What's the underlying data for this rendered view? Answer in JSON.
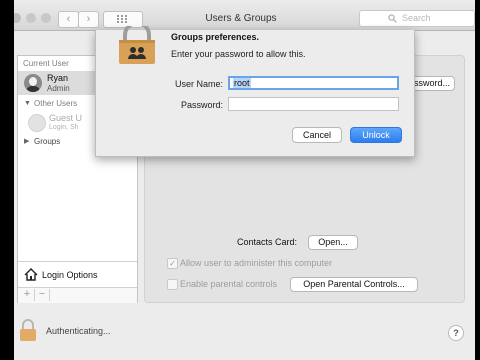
{
  "window": {
    "title": "Users & Groups",
    "search_placeholder": "Search"
  },
  "nav": {
    "back": "‹",
    "forward": "›"
  },
  "sidebar": {
    "current_user_heading": "Current User",
    "current_user": {
      "name": "Ryan",
      "role": "Admin"
    },
    "other_users_heading": "Other Users",
    "guest": {
      "name": "Guest U",
      "subtitle": "Login, Sh"
    },
    "groups_label": "Groups",
    "login_options": "Login Options",
    "add": "+",
    "remove": "−"
  },
  "content": {
    "password_button": "Password...",
    "contacts_card_label": "Contacts Card:",
    "open_button": "Open...",
    "allow_admin_label": "Allow user to administer this computer",
    "allow_admin_checked": true,
    "parental_controls_label": "Enable parental controls",
    "parental_controls_checked": false,
    "open_parental_controls": "Open Parental Controls..."
  },
  "footer": {
    "status": "Authenticating...",
    "help": "?"
  },
  "dialog": {
    "title": "Groups preferences.",
    "message": "Enter your password to allow this.",
    "username_label": "User Name:",
    "username_value": "root",
    "password_label": "Password:",
    "password_value": "",
    "cancel": "Cancel",
    "unlock": "Unlock"
  },
  "colors": {
    "accent": "#3b8ef5",
    "lock": "#d9a158",
    "background": "#000000"
  },
  "icons": [
    "search-icon",
    "grid-icon",
    "house-icon",
    "lock-icon",
    "checkmark-icon",
    "disclosure-triangle-icon"
  ]
}
